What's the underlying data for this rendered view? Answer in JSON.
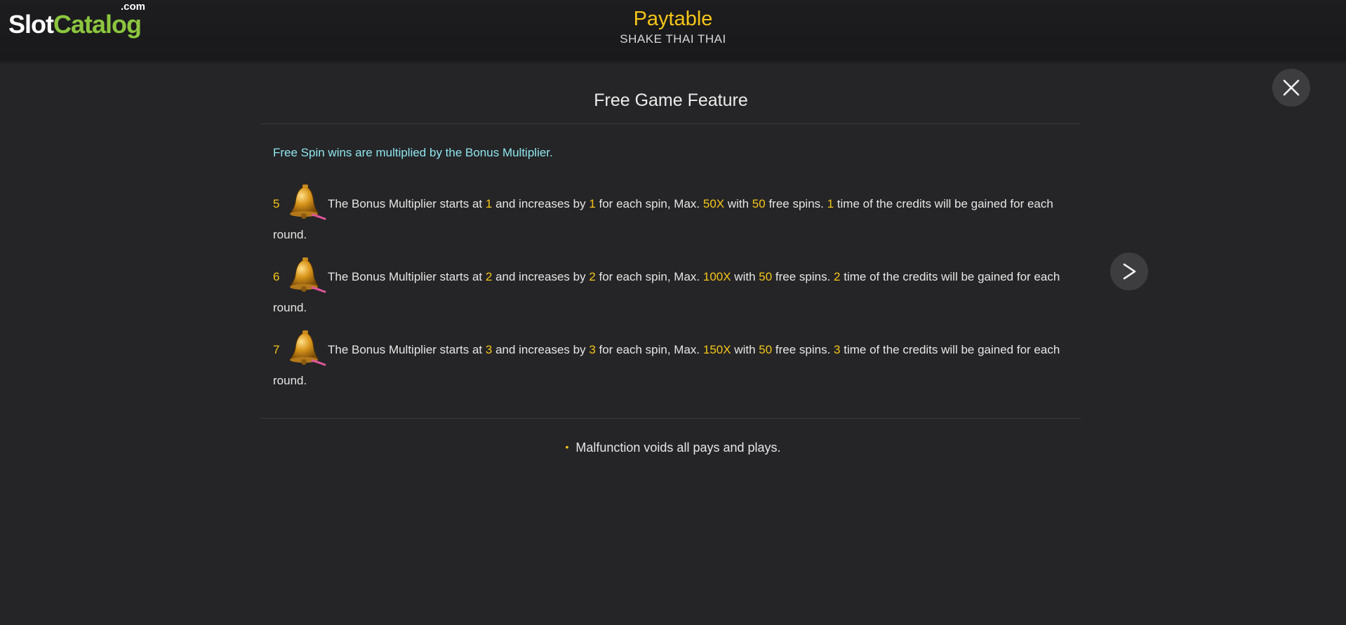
{
  "logo": {
    "slot": "Slot",
    "catalog": "Catalog",
    "com": ".com"
  },
  "header": {
    "title": "Paytable",
    "subtitle": "SHAKE THAI THAI"
  },
  "section": {
    "title": "Free Game Feature",
    "intro": "Free Spin wins are multiplied by the Bonus Multiplier."
  },
  "rows": [
    {
      "count": "5",
      "t1": "The Bonus Multiplier starts at ",
      "start": "1",
      "t2": " and increases by ",
      "inc": "1",
      "t3": " for each spin, Max. ",
      "max": "50X",
      "t4": " with ",
      "spins": "50",
      "t5": " free spins. ",
      "credits": "1",
      "t6": " time of the credits will be gained for each round."
    },
    {
      "count": "6",
      "t1": "The Bonus Multiplier starts at ",
      "start": "2",
      "t2": " and increases by ",
      "inc": "2",
      "t3": " for each spin, Max. ",
      "max": "100X",
      "t4": " with ",
      "spins": "50",
      "t5": " free spins. ",
      "credits": "2",
      "t6": " time of the credits will be gained for each round."
    },
    {
      "count": "7",
      "t1": "The Bonus Multiplier starts at ",
      "start": "3",
      "t2": " and increases by ",
      "inc": "3",
      "t3": " for each spin, Max. ",
      "max": "150X",
      "t4": " with ",
      "spins": "50",
      "t5": " free spins. ",
      "credits": "3",
      "t6": " time of the credits will be gained for each round."
    }
  ],
  "footer": {
    "bullet": "•",
    "text": "Malfunction voids all pays and plays."
  },
  "icons": {
    "close": "close-icon",
    "next": "chevron-right-icon",
    "symbol": "bell-icon"
  },
  "colors": {
    "accent": "#f5c518",
    "intro": "#8fe6ef",
    "brand_green": "#8cc63f",
    "background": "#252527"
  }
}
